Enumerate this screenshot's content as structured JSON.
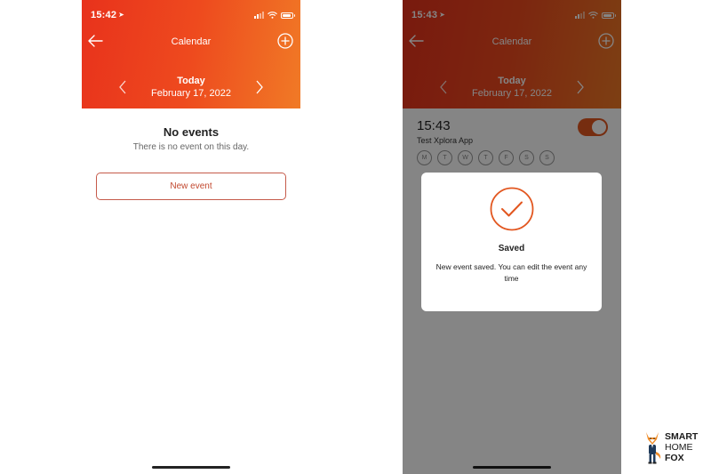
{
  "left_screen": {
    "status_time": "15:42",
    "nav_title": "Calendar",
    "date_label": "Today",
    "date_full": "February 17, 2022",
    "empty_title": "No events",
    "empty_subtitle": "There is no event on this day.",
    "new_event_label": "New event"
  },
  "right_screen": {
    "status_time": "15:43",
    "nav_title": "Calendar",
    "date_label": "Today",
    "date_full": "February 17, 2022",
    "event": {
      "time": "15:43",
      "name": "Test Xplora App",
      "enabled": true,
      "days": [
        "M",
        "T",
        "W",
        "T",
        "F",
        "S",
        "S"
      ]
    },
    "dialog": {
      "title": "Saved",
      "message": "New event saved. You can edit the event any time"
    }
  },
  "brand": {
    "lines": [
      "SMART",
      "HOME",
      "FOX"
    ]
  },
  "colors": {
    "header_start": "#e8321c",
    "header_end": "#f07a26",
    "accent": "#e2561f",
    "button_border": "#c55a4a"
  },
  "icons": {
    "back": "arrow-left-icon",
    "add": "plus-circle-icon",
    "prev": "chevron-left-icon",
    "next": "chevron-right-icon",
    "saved": "check-circle-icon",
    "location": "location-arrow-icon"
  }
}
